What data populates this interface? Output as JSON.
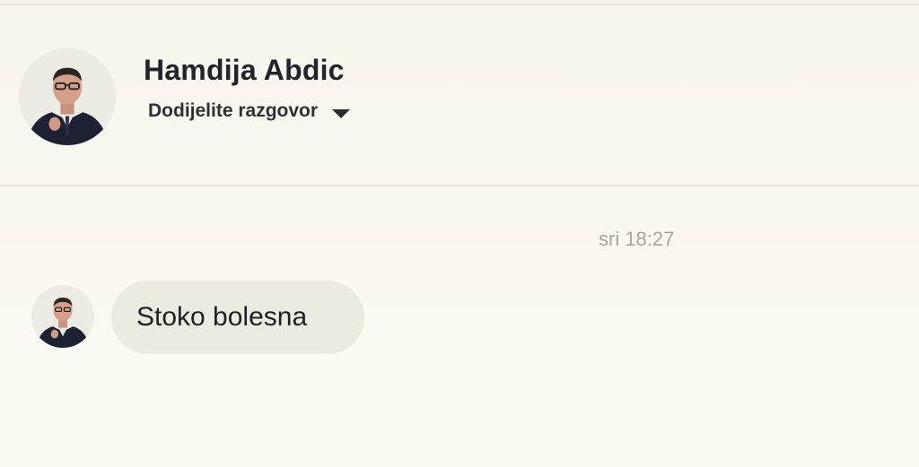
{
  "header": {
    "contact_name": "Hamdija Abdic",
    "assign_label": "Dodijelite razgovor",
    "assign_icon": "caret-down-icon"
  },
  "conversation": {
    "timestamp": "sri 18:27",
    "messages": [
      {
        "sender": "Hamdija Abdic",
        "text": "Stoko bolesna"
      }
    ]
  },
  "colors": {
    "background": "#f8f7ef",
    "bubble": "#ecebe2",
    "name_text": "#23232b",
    "timestamp_text": "#a5a49e"
  }
}
